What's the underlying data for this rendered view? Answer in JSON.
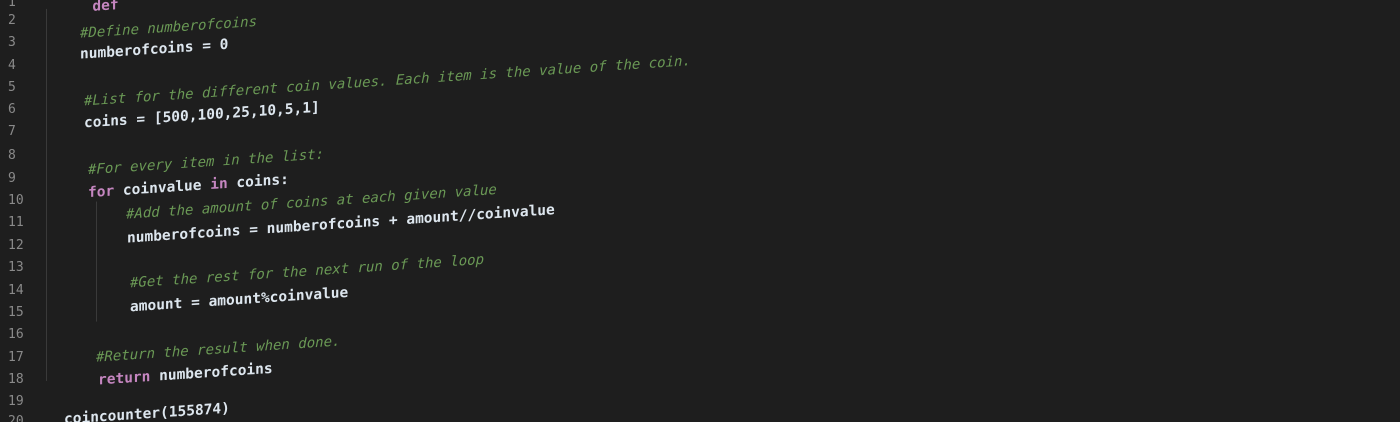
{
  "editor": {
    "line_numbers": [
      "1",
      "2",
      "3",
      "4",
      "5",
      "6",
      "7",
      "8",
      "9",
      "10",
      "11",
      "12",
      "13",
      "14",
      "15",
      "16",
      "17",
      "18",
      "19",
      "20"
    ],
    "lines": {
      "top_fragment": "def",
      "comment_define": "#Define numberofcoins",
      "assign_zero": "numberofcoins = 0",
      "comment_list": "#List for the different coin values. Each item is the value of the coin.",
      "coins_list": "coins = [500,100,25,10,5,1]",
      "comment_every": "#For every item in the list:",
      "for_kw": "for",
      "for_var": " coinvalue ",
      "in_kw": "in",
      "for_rest": " coins:",
      "comment_add": "#Add the amount of coins at each given value",
      "sum_line": "numberofcoins = numberofcoins + amount//coinvalue",
      "comment_rest": "#Get the rest for the next run of the loop",
      "mod_line": "amount = amount%coinvalue",
      "comment_return": "#Return the result when done.",
      "return_kw": "return",
      "return_val": " numberofcoins",
      "call_line": "coincounter(155874)"
    }
  },
  "colors": {
    "background": "#1e1e1e",
    "comment": "#6a9955",
    "keyword": "#c586c0",
    "identifier": "#dde6ee",
    "line_number": "#8a8a8a"
  }
}
